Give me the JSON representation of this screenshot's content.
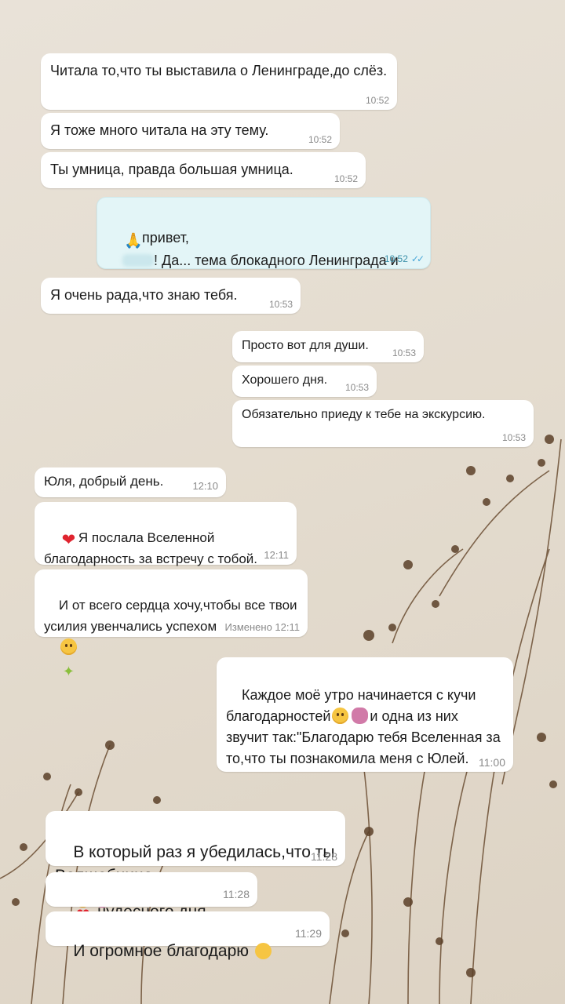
{
  "messages": [
    {
      "text": "Читала то,что ты выставила о Ленинграде,до слёз.",
      "time": "10:52"
    },
    {
      "text": "Я тоже много читала на эту тему.",
      "time": "10:52"
    },
    {
      "text": "Ты умница, правда большая умница.",
      "time": "10:52"
    },
    {
      "text_a": "привет,",
      "text_b": "! Да... тема блокадного Ленинграда и для меня всегда до слез",
      "time": "10:52"
    },
    {
      "text": "Я очень рада,что знаю тебя.",
      "time": "10:53"
    },
    {
      "text": "Просто вот для души.",
      "time": "10:53"
    },
    {
      "text": "Хорошего дня.",
      "time": "10:53"
    },
    {
      "text": "Обязательно приеду к тебе на экскурсию.",
      "time": "10:53"
    },
    {
      "text": "Юля, добрый день.",
      "time": "12:10"
    },
    {
      "text": "Я послала Вселенной благодарность за встречу с тобой.",
      "time": "12:11"
    },
    {
      "text": "И от всего сердца хочу,чтобы все твои усилия увенчались успехом",
      "time": "Изменено 12:11"
    },
    {
      "text_a": "Каждое моё утро начинается с кучи благодарностей",
      "text_b": "и одна из них звучит так:\"Благодарю тебя Вселенная за то,что ты познакомила меня с Юлей.",
      "time": "11:00"
    },
    {
      "text": "В который раз я убедилась,что ты Волшебница",
      "time": "11:28"
    },
    {
      "text": "чудесного дня",
      "time": "11:28"
    },
    {
      "text": "И огромное благодарю",
      "time": "11:29"
    }
  ]
}
